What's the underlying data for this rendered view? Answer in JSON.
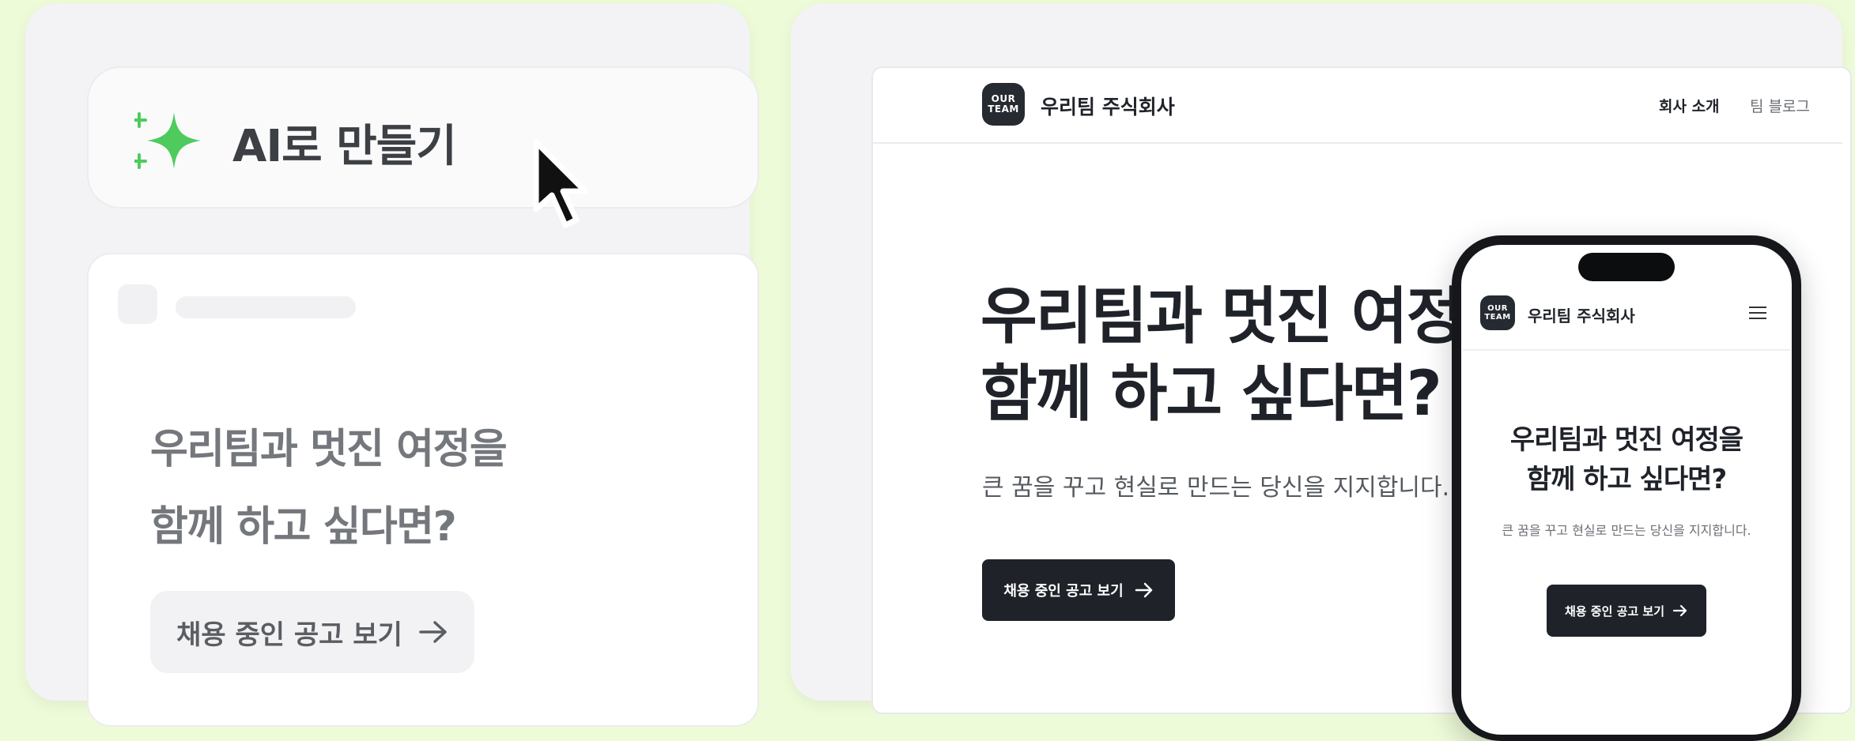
{
  "editor": {
    "ai_button_label": "AI로 만들기",
    "sparkle_icon": "sparkle-icon",
    "cursor_icon": "mouse-pointer-icon",
    "accent_color": "#4fcb5e",
    "preview": {
      "heading_line1": "우리팀과 멋진 여정을",
      "heading_line2": "함께 하고 싶다면?",
      "button_label": "채용 중인 공고 보기",
      "button_icon": "arrow-right-icon"
    }
  },
  "site": {
    "logo_line1": "OUR",
    "logo_line2": "TEAM",
    "company_name": "우리팀 주식회사",
    "nav": [
      "회사 소개",
      "팀 블로그"
    ],
    "hero_heading_line1": "우리팀과 멋진 여정을",
    "hero_heading_line2": "함께 하고 싶다면?",
    "hero_subtitle": "큰 꿈을 꾸고 현실로 만드는 당신을 지지합니다.",
    "cta_label": "채용 중인 공고 보기",
    "cta_icon": "arrow-right-icon",
    "dark_color": "#1f2329"
  },
  "mobile": {
    "logo_line1": "OUR",
    "logo_line2": "TEAM",
    "company_name": "우리팀 주식회사",
    "menu_icon": "hamburger-menu-icon",
    "heading_line1": "우리팀과 멋진 여정을",
    "heading_line2": "함께 하고 싶다면?",
    "subtitle": "큰 꿈을 꾸고 현실로 만드는 당신을 지지합니다.",
    "cta_label": "채용 중인 공고 보기"
  }
}
